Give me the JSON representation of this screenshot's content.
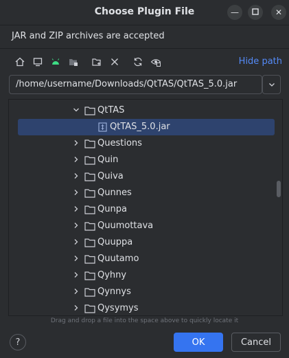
{
  "window": {
    "title": "Choose Plugin File",
    "controls": [
      "minimize-icon",
      "maximize-icon",
      "close-icon"
    ]
  },
  "description": "JAR and ZIP archives are accepted",
  "toolbar": {
    "icons": [
      "home-icon",
      "desktop-icon",
      "android-icon",
      "module-icon",
      "new-folder-icon",
      "delete-icon",
      "refresh-icon",
      "show-hidden-icon"
    ],
    "hide_path_label": "Hide path"
  },
  "path": {
    "value": "/home/username/Downloads/QtTAS/QtTAS_5.0.jar"
  },
  "tree": {
    "expanded_folder": "QtTAS",
    "selected_file": "QtTAS_5.0.jar",
    "folders": [
      "Questions",
      "Quin",
      "Quiva",
      "Qunnes",
      "Qunpa",
      "Quumottava",
      "Quuppa",
      "Quutamo",
      "Qyhny",
      "Qynnys",
      "Qysymys"
    ]
  },
  "hint": "Drag and drop a file into the space above to quickly locate it",
  "buttons": {
    "help": "?",
    "ok": "OK",
    "cancel": "Cancel"
  },
  "colors": {
    "accent": "#3574f0",
    "link": "#548af7",
    "selection": "#2e436e",
    "background": "#2b2d30"
  }
}
